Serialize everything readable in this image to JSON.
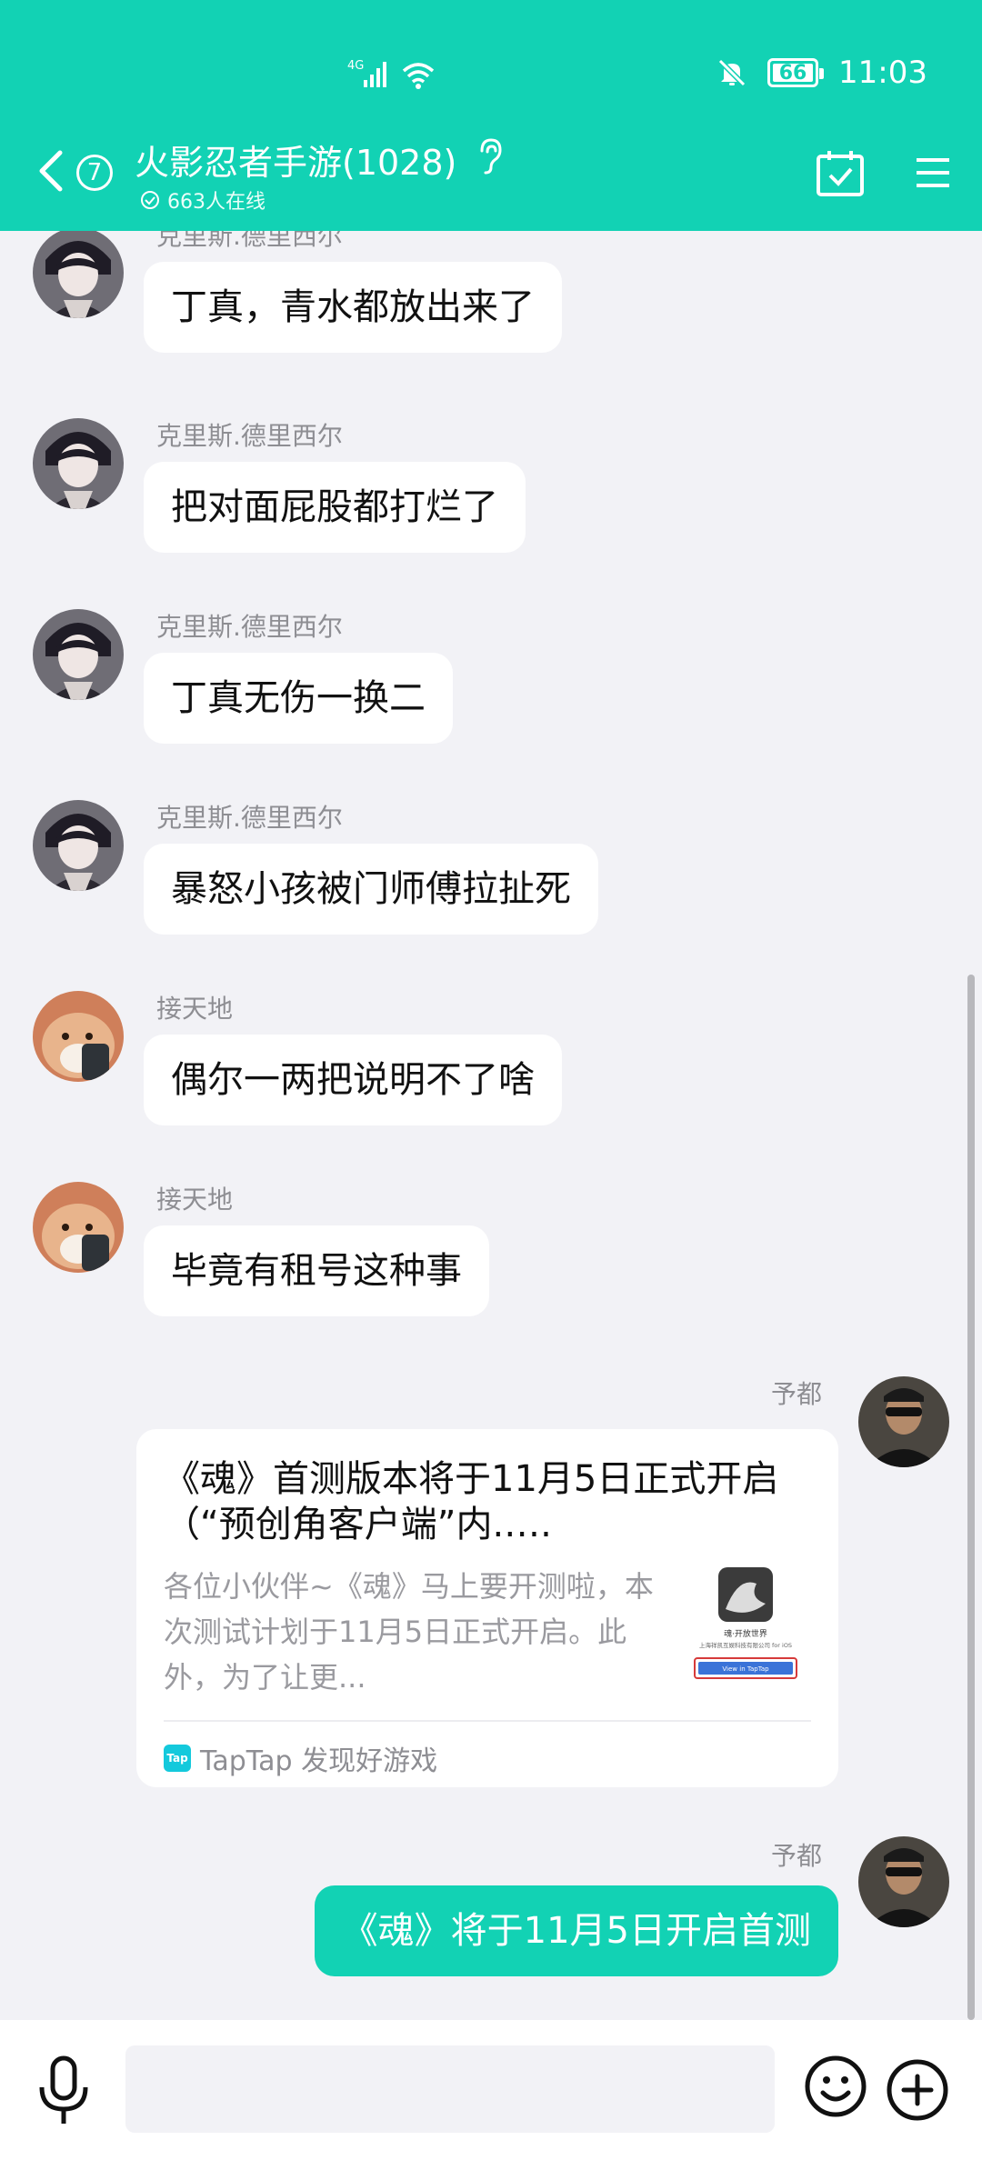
{
  "status_bar": {
    "network": "4G",
    "battery": "66",
    "time": "11:03"
  },
  "header": {
    "unread_count": "7",
    "group_title": "火影忍者手游(1028)",
    "online": "663人在线"
  },
  "messages": [
    {
      "sender": "克里斯.德里西尔",
      "text": "丁真，青水都放出来了"
    },
    {
      "sender": "克里斯.德里西尔",
      "text": "把对面屁股都打烂了"
    },
    {
      "sender": "克里斯.德里西尔",
      "text": "丁真无伤一换二"
    },
    {
      "sender": "克里斯.德里西尔",
      "text": "暴怒小孩被门师傅拉扯死"
    },
    {
      "sender": "接天地",
      "text": "偶尔一两把说明不了啥"
    },
    {
      "sender": "接天地",
      "text": "毕竟有租号这种事"
    },
    {
      "sender": "予都",
      "card": {
        "title": "《魂》首测版本将于11月5日正式开启（“预创角客户端”内.….",
        "description": "各位小伙伴~《魂》马上要开测啦，本次测试计划于11月5日正式开启。此外，为了让更...",
        "thumb_title": "魂·开放世界",
        "thumb_company": "上海祥凯互娱科技有限公司 for iOS",
        "thumb_button": "View in TapTap",
        "source_logo": "Tap",
        "source": "TapTap 发现好游戏"
      }
    },
    {
      "sender": "予都",
      "text": "《魂》将于11月5日开启首测"
    }
  ],
  "input": {
    "placeholder": ""
  }
}
